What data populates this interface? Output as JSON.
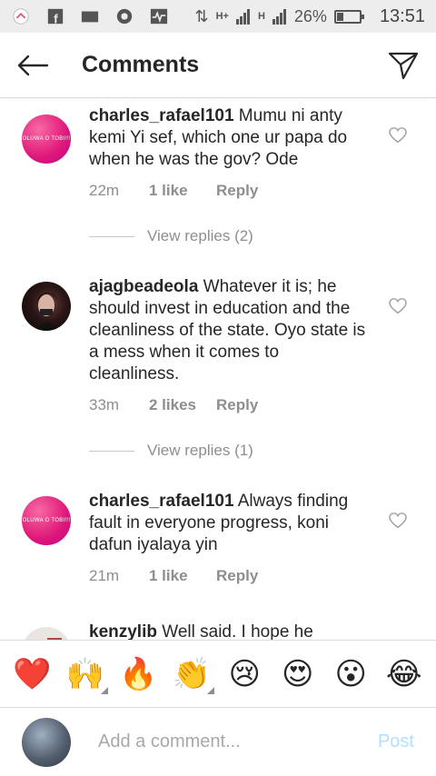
{
  "status_bar": {
    "battery": "26%",
    "time": "13:51",
    "network_a": "H+",
    "network_b": "H",
    "data_arrows": "⇅"
  },
  "header": {
    "title": "Comments",
    "back_icon": "arrow-left-icon",
    "send_icon": "paper-plane-icon"
  },
  "comments": [
    {
      "username": "charles_rafael101",
      "text": "Mumu ni anty kemi Yi sef, which one ur papa do when he was the gov? Ode",
      "time": "22m",
      "likes": "1 like",
      "reply": "Reply",
      "avatar_text": "OLUWA O TOBI!!!",
      "view_replies": "View replies (2)"
    },
    {
      "username": "ajagbeadeola",
      "text": "Whatever it is; he should invest in education and the cleanliness of the state. Oyo state is a mess when it comes to cleanliness.",
      "time": "33m",
      "likes": "2 likes",
      "reply": "Reply",
      "view_replies": "View replies (1)"
    },
    {
      "username": "charles_rafael101",
      "text": "Always finding fault in everyone progress, koni dafun iyalaya yin",
      "time": "21m",
      "likes": "1 like",
      "reply": "Reply",
      "avatar_text": "OLUWA O TOBI!!!"
    },
    {
      "username": "kenzylib",
      "text": "Well said. I hope he"
    }
  ],
  "emoji_bar": [
    "❤️",
    "🙌",
    "🔥",
    "👏",
    "😢",
    "😍",
    "😮",
    "😂"
  ],
  "input": {
    "placeholder": "Add a comment...",
    "post_label": "Post"
  },
  "colors": {
    "accent_post": "#b2dffc",
    "muted_text": "#8e8e8e",
    "avatar_pink": "#e0167a"
  }
}
